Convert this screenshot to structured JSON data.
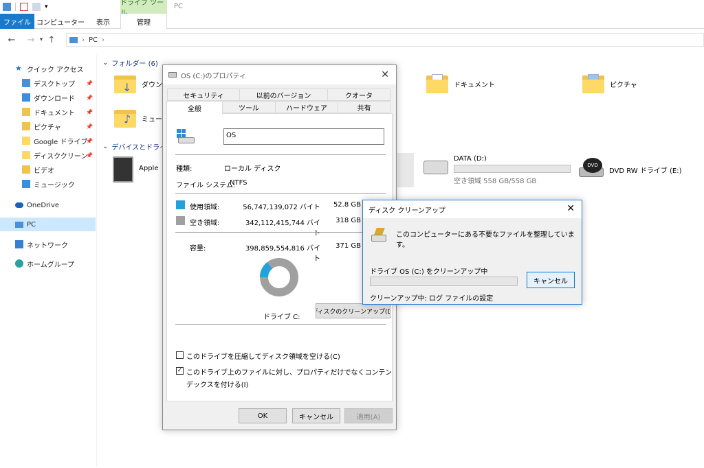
{
  "ribbon": {
    "tools_context": "ドライブ ツール",
    "window_title": "PC",
    "tabs": [
      "ファイル",
      "コンピューター",
      "表示"
    ],
    "manage_tab": "管理"
  },
  "address": {
    "path": "PC"
  },
  "nav": {
    "quick_access": "クイック アクセス",
    "items": [
      "デスクトップ",
      "ダウンロード",
      "ドキュメント",
      "ピクチャ",
      "Google ドライブ",
      "ディスククリーンアップ",
      "ビデオ",
      "ミュージック"
    ],
    "onedrive": "OneDrive",
    "pc": "PC",
    "network": "ネットワーク",
    "homegroup": "ホームグループ"
  },
  "content": {
    "folders_group": "フォルダー (6)",
    "devices_group": "デバイスとドライブ",
    "folders": [
      "ダウンロ",
      "ミュージ",
      "ドキュメント",
      "ピクチャ"
    ],
    "device_apple": "Apple",
    "data_drive": {
      "name": "DATA (D:)",
      "free": "空き領域 558 GB/558 GB",
      "used_fraction": 0.0
    },
    "dvd_drive": {
      "name": "DVD RW ドライブ (E:)",
      "icon_text": "DVD"
    }
  },
  "props": {
    "title": "OS (C:)のプロパティ",
    "tabs_row1": [
      "セキュリティ",
      "以前のバージョン",
      "クオータ"
    ],
    "tabs_row2": [
      "全般",
      "ツール",
      "ハードウェア",
      "共有"
    ],
    "name_value": "OS",
    "type_label": "種類:",
    "type_value": "ローカル ディスク",
    "fs_label": "ファイル システム:",
    "fs_value": "NTFS",
    "used_label": "使用領域:",
    "used_bytes": "56,747,139,072 バイト",
    "used_gb": "52.8 GB",
    "free_label": "空き領域:",
    "free_bytes": "342,112,415,744 バイト",
    "free_gb": "318 GB",
    "cap_label": "容量:",
    "cap_bytes": "398,859,554,816 バイト",
    "cap_gb": "371 GB",
    "drive_label": "ドライブ C:",
    "cleanup_button": "ディスクのクリーンアップ(D)",
    "compress_label": "このドライブを圧縮してディスク領域を空ける(C)",
    "index_label_1": "このドライブ上のファイルに対し、プロパティだけでなくコンテンツにもイン",
    "index_label_2": "デックスを付ける(I)",
    "ok": "OK",
    "cancel": "キャンセル",
    "apply": "適用(A)",
    "used_color": "#26a0da",
    "free_color": "#a0a0a0",
    "used_fraction": 0.1423
  },
  "cleanup": {
    "title": "ディスク クリーンアップ",
    "message": "このコンピューターにある不要なファイルを整理しています。",
    "progress_label": "ドライブ OS (C:) をクリーンアップ中",
    "cancel": "キャンセル",
    "status": "クリーンアップ中:  ログ ファイルの設定"
  }
}
